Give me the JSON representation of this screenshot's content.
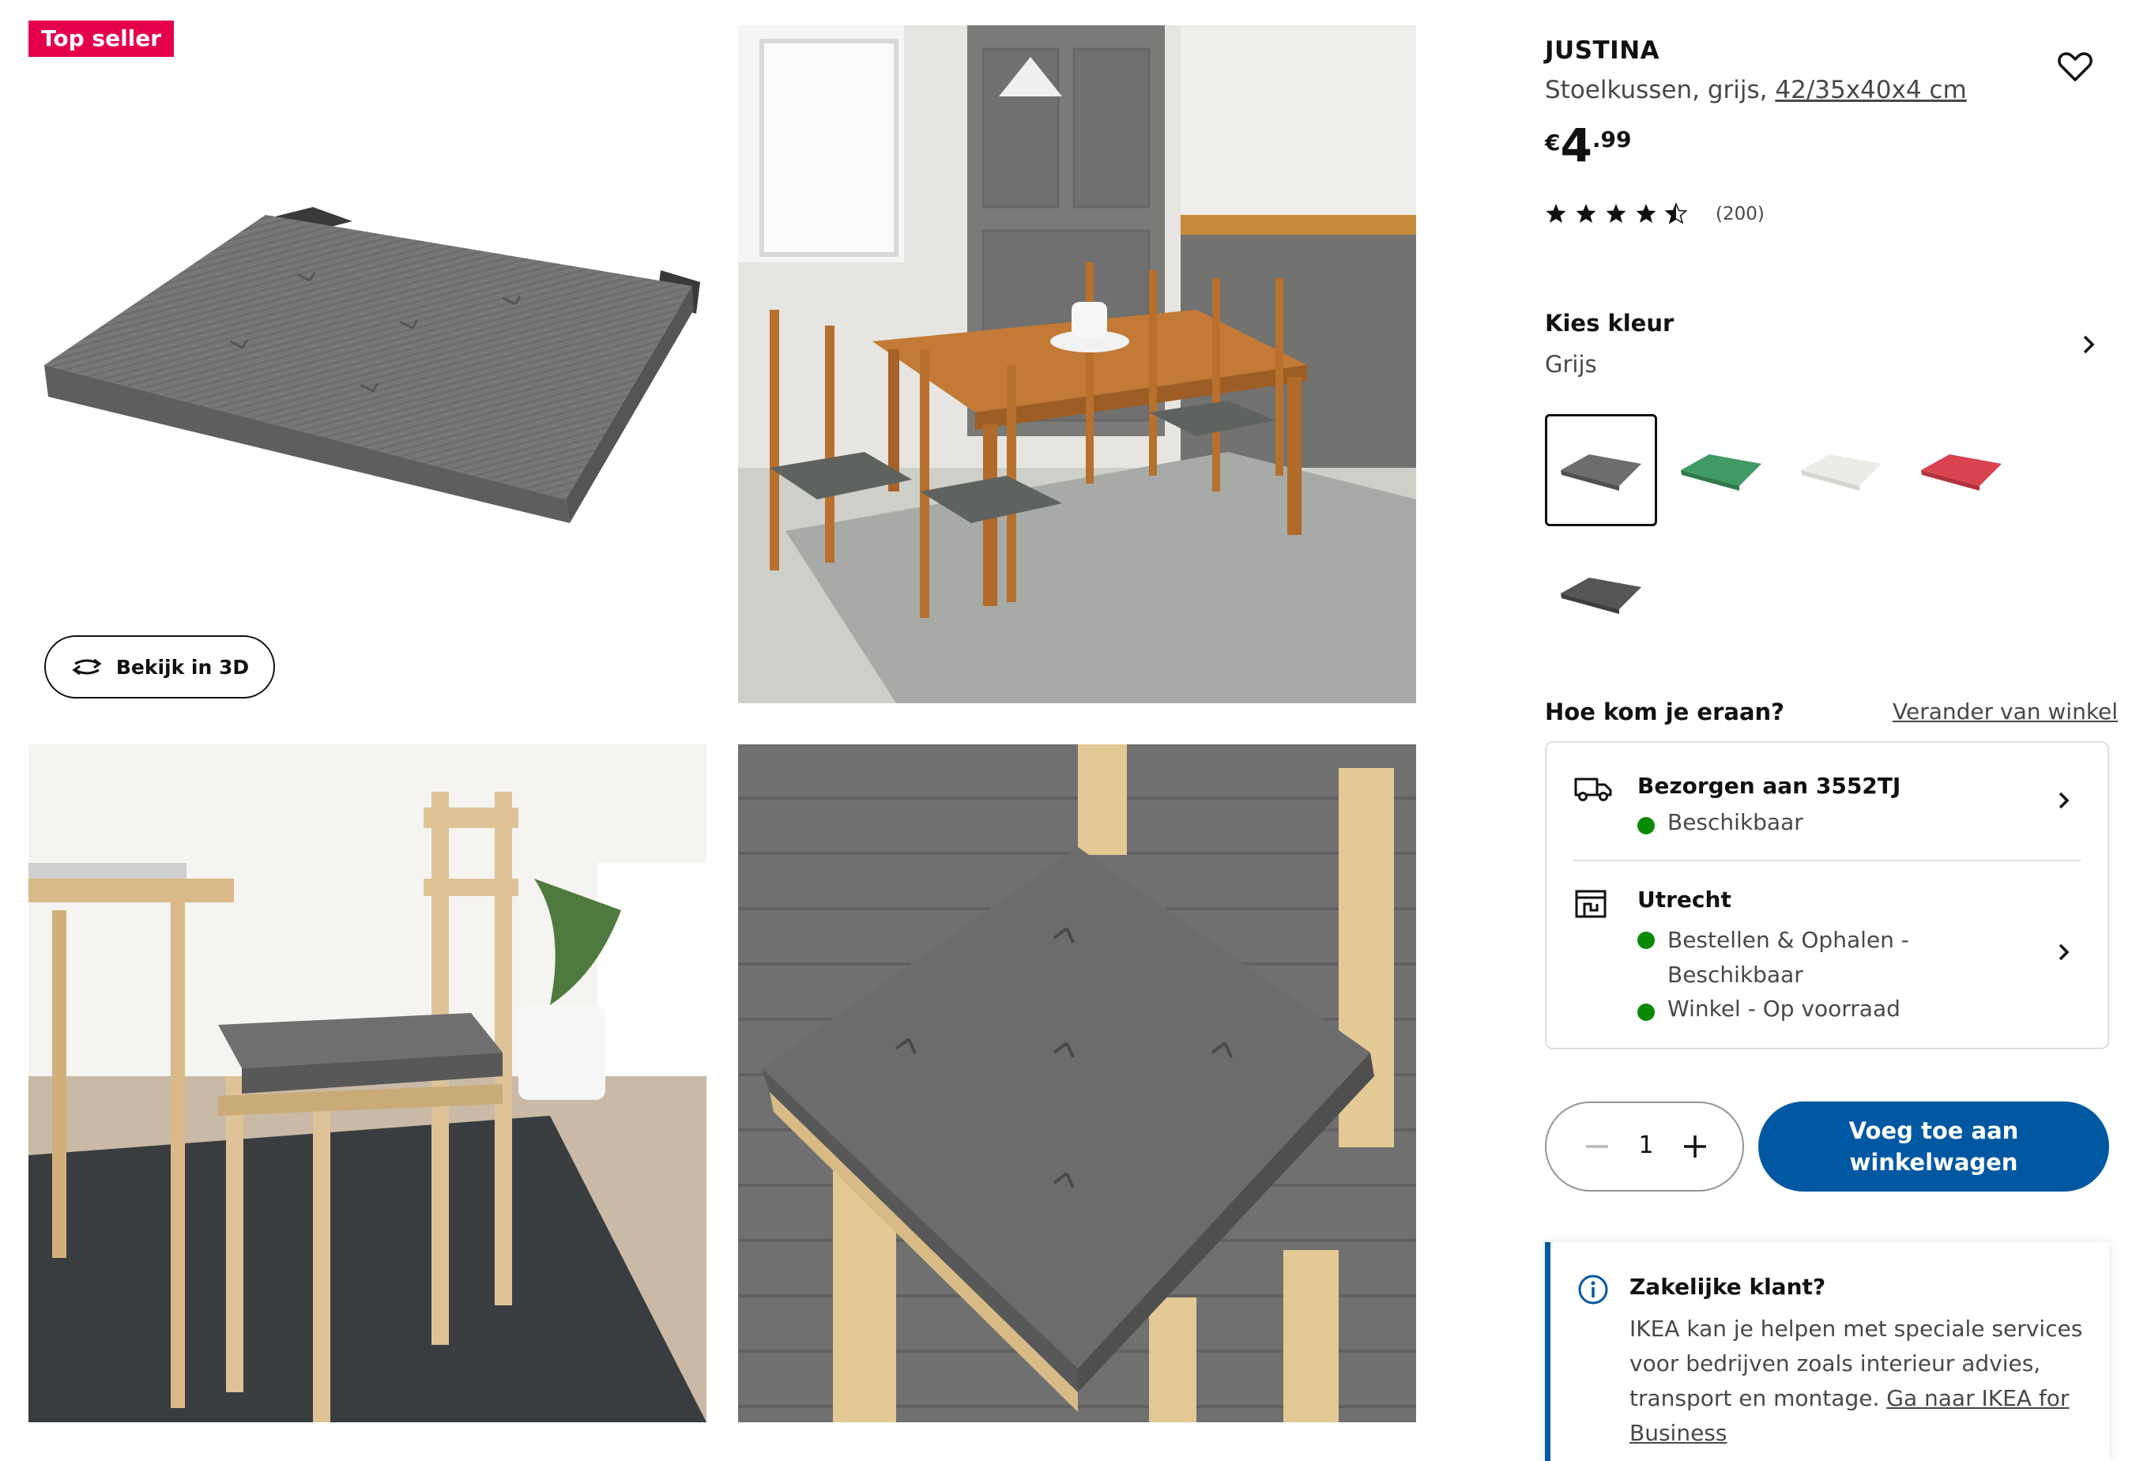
{
  "badge": "Top seller",
  "view3d": {
    "label": "Bekijk in 3D"
  },
  "product": {
    "name": "JUSTINA",
    "description": "Stoelkussen, grijs, ",
    "dimensions": "42/35x40x4 cm",
    "price": {
      "currency": "€",
      "integer": "4",
      "decimals": ".99"
    },
    "rating": {
      "stars": 4.5,
      "count": "(200)"
    }
  },
  "color": {
    "title": "Kies kleur",
    "value": "Grijs",
    "swatches": [
      {
        "name": "grijs",
        "color": "#6d6d6d",
        "selected": true
      },
      {
        "name": "groen",
        "color": "#3f9a63",
        "selected": false
      },
      {
        "name": "wit",
        "color": "#ecebe6",
        "selected": false
      },
      {
        "name": "rood",
        "color": "#d9424f",
        "selected": false
      },
      {
        "name": "donkergrijs",
        "color": "#555555",
        "selected": false
      }
    ]
  },
  "availability": {
    "title": "Hoe kom je eraan?",
    "change_store": "Verander van winkel",
    "delivery": {
      "title": "Bezorgen aan 3552TJ",
      "status": "Beschikbaar"
    },
    "store": {
      "title": "Utrecht",
      "status1": "Bestellen & Ophalen - Beschikbaar",
      "status2": "Winkel - Op voorraad"
    }
  },
  "cart": {
    "quantity": "1",
    "add_label": "Voeg toe aan winkelwagen"
  },
  "business": {
    "title": "Zakelijke klant?",
    "text": "IKEA kan je helpen met speciale services voor bedrijven zoals interieur advies, transport en montage. ",
    "link": "Ga naar IKEA for Business"
  },
  "colors": {
    "accent": "#0058a3",
    "badge": "#e5004c",
    "available": "#0a8a00"
  }
}
